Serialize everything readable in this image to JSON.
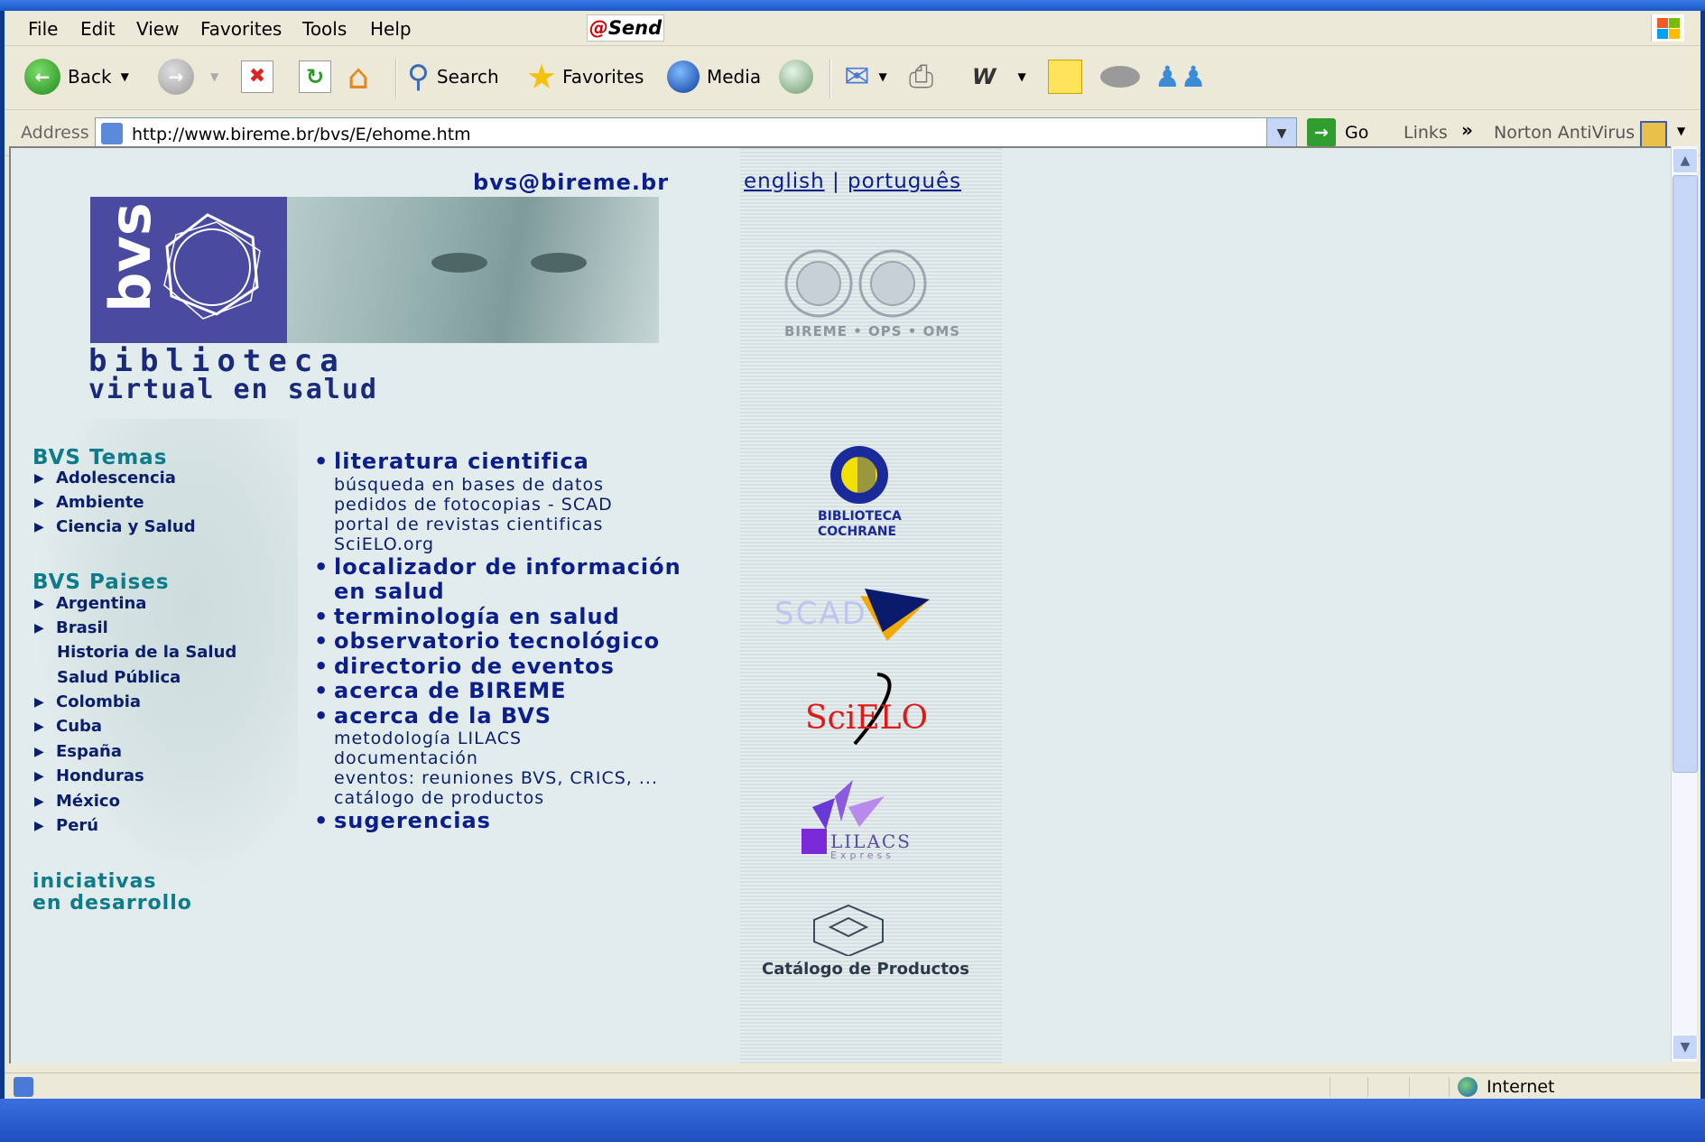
{
  "menu": [
    "File",
    "Edit",
    "View",
    "Favorites",
    "Tools",
    "Help"
  ],
  "send_logo": "Send",
  "toolbar": {
    "back": "Back",
    "search": "Search",
    "favorites": "Favorites",
    "media": "Media"
  },
  "address": {
    "label": "Address",
    "url": "http://www.bireme.br/bvs/E/ehome.htm",
    "go": "Go",
    "links": "Links",
    "norton": "Norton AntiVirus"
  },
  "status": {
    "zone": "Internet"
  },
  "page": {
    "email": "bvs@bireme.br",
    "lang_en": "english",
    "lang_sep": "|",
    "lang_pt": "português",
    "bvs_logo_word": "bvs",
    "title_line1": "biblioteca",
    "title_line2": "virtual en salud",
    "temas_heading": "BVS Temas",
    "temas": [
      "Adolescencia",
      "Ambiente",
      "Ciencia y Salud"
    ],
    "paises_heading": "BVS Paises",
    "paises": [
      "Argentina",
      "Brasil",
      "Historia de la Salud",
      "Salud Pública",
      "Colombia",
      "Cuba",
      "España",
      "Honduras",
      "México",
      "Perú"
    ],
    "iniciativas_1": "iniciativas",
    "iniciativas_2": "en desarrollo",
    "main": {
      "literatura": "literatura cientifica",
      "literatura_subs": [
        "búsqueda en bases de datos",
        "pedidos de fotocopias - SCAD",
        "portal de revistas cientificas",
        "SciELO.org"
      ],
      "localizador_1": "localizador de información",
      "localizador_2": "en salud",
      "terminologia": "terminología en salud",
      "observatorio": "observatorio tecnológico",
      "directorio": "directorio de eventos",
      "acerca_bireme": "acerca de BIREME",
      "acerca_bvs": "acerca de la BVS",
      "acerca_bvs_subs": [
        "metodología LILACS",
        "documentación",
        "eventos: reuniones BVS, CRICS, ...",
        "catálogo de productos"
      ],
      "sugerencias": "sugerencias"
    },
    "logos": {
      "bireme": "BIREME • OPS • OMS",
      "cochrane_1": "BIBLIOTECA",
      "cochrane_2": "COCHRANE",
      "scad": "SCAD",
      "scielo": "SciELO",
      "lilacs": "LILACS",
      "lilacs_sub": "Express",
      "catalogo": "Catálogo de Productos"
    }
  },
  "colors": {
    "link": "#0a1e8c",
    "heading": "#0d7b8a",
    "page_bg": "#e3ecec",
    "bvs_purple": "#4a4aa0"
  }
}
